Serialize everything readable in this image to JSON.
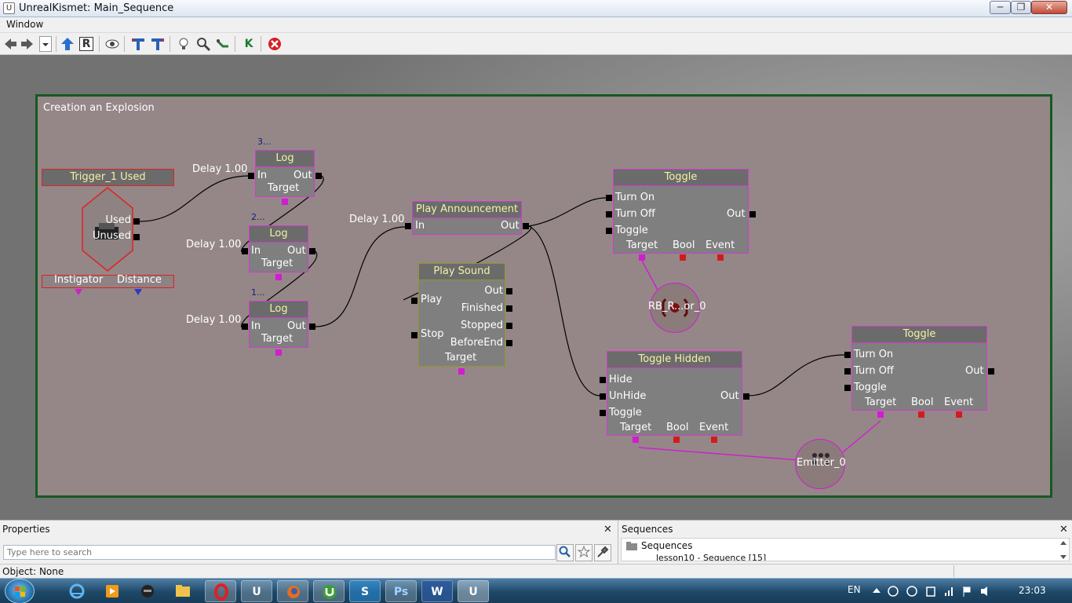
{
  "window": {
    "title": "UnrealKismet: Main_Sequence",
    "icon_text": "U",
    "min_glyph": "─",
    "max_glyph": "❐",
    "close_glyph": "✕"
  },
  "menu": {
    "window_label": "Window"
  },
  "toolbar": {
    "icons": [
      "back-icon",
      "forward-icon",
      "dropdown-icon",
      "up-arrow-icon",
      "r-icon",
      "eye-icon",
      "t-icon-1",
      "t-icon-2",
      "bulb-icon",
      "zoom-icon",
      "link-icon",
      "k-icon",
      "stop-icon"
    ],
    "r_label": "R",
    "k_label": "K"
  },
  "sequence": {
    "title": "Creation an Explosion",
    "trigger": {
      "title": "Trigger_1 Used",
      "out_used": "Used",
      "out_unused": "Unused",
      "var_instigator": "Instigator",
      "var_distance": "Distance"
    },
    "logs": [
      {
        "title": "Log",
        "badge": "3...",
        "delay": "Delay 1.00",
        "in": "In",
        "out": "Out",
        "target": "Target"
      },
      {
        "title": "Log",
        "badge": "2...",
        "delay": "Delay 1.00",
        "in": "In",
        "out": "Out",
        "target": "Target"
      },
      {
        "title": "Log",
        "badge": "1...",
        "delay": "Delay 1.00",
        "in": "In",
        "out": "Out",
        "target": "Target"
      }
    ],
    "play_announcement": {
      "title": "Play Announcement",
      "delay": "Delay 1.00",
      "in": "In",
      "out": "Out"
    },
    "play_sound": {
      "title": "Play Sound",
      "play": "Play",
      "stop": "Stop",
      "out": "Out",
      "finished": "Finished",
      "stopped": "Stopped",
      "before_end": "BeforeEnd",
      "target": "Target"
    },
    "toggle_1": {
      "title": "Toggle",
      "turn_on": "Turn On",
      "turn_off": "Turn Off",
      "toggle": "Toggle",
      "out": "Out",
      "target": "Target",
      "bool": "Bool",
      "event": "Event"
    },
    "rb_var": {
      "label": "RB_R...or_0"
    },
    "toggle_hidden": {
      "title": "Toggle Hidden",
      "hide": "Hide",
      "unhide": "UnHide",
      "toggle": "Toggle",
      "out": "Out",
      "target": "Target",
      "bool": "Bool",
      "event": "Event"
    },
    "toggle_2": {
      "title": "Toggle",
      "turn_on": "Turn On",
      "turn_off": "Turn Off",
      "toggle": "Toggle",
      "out": "Out",
      "target": "Target",
      "bool": "Bool",
      "event": "Event"
    },
    "emitter_var": {
      "label": "Emitter_0"
    }
  },
  "properties_panel": {
    "header": "Properties",
    "close": "✕",
    "search_placeholder": "Type here to search"
  },
  "sequences_panel": {
    "header": "Sequences",
    "close": "✕",
    "root": "Sequences",
    "child": "lesson10 - Sequence [15]"
  },
  "status": {
    "text": "Object: None"
  },
  "taskbar": {
    "apps": [
      "ie-icon",
      "media-icon",
      "game-icon",
      "folder-icon",
      "opera-icon",
      "unreal-icon",
      "firefox-icon",
      "utorrent-icon",
      "skype-icon",
      "photoshop-icon",
      "word-icon",
      "unreal-kismet-icon"
    ],
    "unreal_label": "U",
    "ps_label": "Ps",
    "word_label": "W",
    "skype_label": "S",
    "lang": "EN",
    "time": "23:03"
  }
}
